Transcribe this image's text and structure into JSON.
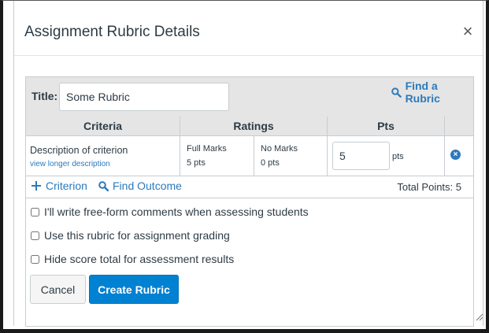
{
  "dialog": {
    "title": "Assignment Rubric Details",
    "close_symbol": "×"
  },
  "rubric": {
    "title_label": "Title:",
    "title_value": "Some Rubric",
    "find_rubric_label": "Find a Rubric",
    "columns": [
      "Criteria",
      "Ratings",
      "Pts"
    ],
    "criterion": {
      "description": "Description of criterion",
      "longer_link": "view longer description",
      "ratings": [
        {
          "name": "Full Marks",
          "points": "5 pts"
        },
        {
          "name": "No Marks",
          "points": "0 pts"
        }
      ],
      "points_value": "5",
      "points_unit": "pts"
    },
    "add_criterion_label": "Criterion",
    "find_outcome_label": "Find Outcome",
    "total_points": "Total Points: 5"
  },
  "options": [
    {
      "label": "I'll write free-form comments when assessing students",
      "checked": false
    },
    {
      "label": "Use this rubric for assignment grading",
      "checked": false
    },
    {
      "label": "Hide score total for assessment results",
      "checked": false
    }
  ],
  "buttons": {
    "cancel": "Cancel",
    "create": "Create Rubric"
  },
  "icons": {
    "close": "close-icon",
    "search": "search-icon",
    "add": "plus-icon",
    "delete": "delete-circle-icon",
    "resize": "resize-grip-icon"
  },
  "colors": {
    "link": "#2b7abc",
    "primary_button": "#0081d1",
    "header_bg": "#e5e5e5",
    "border": "#c7cdd1"
  }
}
